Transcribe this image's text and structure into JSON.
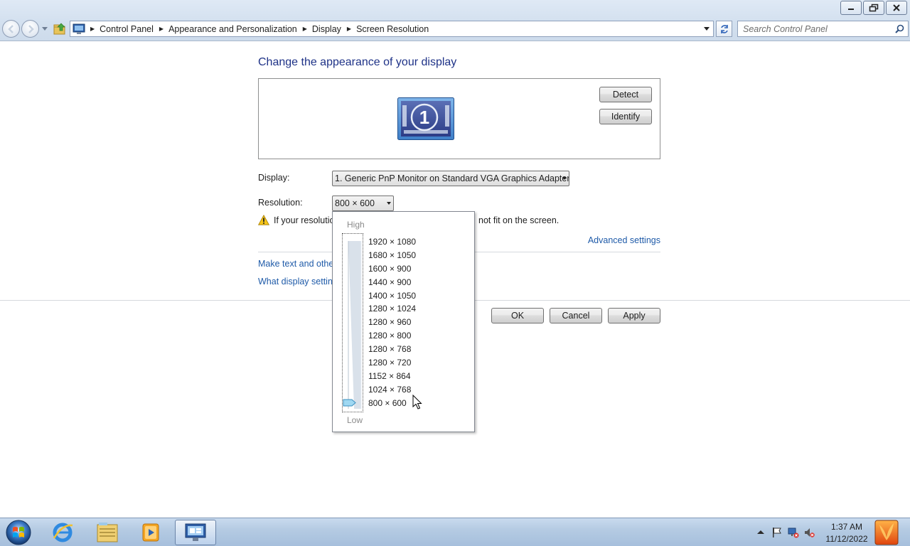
{
  "window": {
    "caption_buttons": [
      "minimize-icon",
      "restore-icon",
      "close-icon"
    ]
  },
  "nav": {
    "breadcrumbs": [
      "Control Panel",
      "Appearance and Personalization",
      "Display",
      "Screen Resolution"
    ],
    "search_placeholder": "Search Control Panel"
  },
  "main": {
    "title": "Change the appearance of your display",
    "monitor_number": "1",
    "detect_label": "Detect",
    "identify_label": "Identify",
    "display_label": "Display:",
    "display_value": "1. Generic PnP Monitor on Standard VGA Graphics Adapter",
    "resolution_label": "Resolution:",
    "resolution_value": "800 × 600",
    "warning_text_start": "If your resolutio",
    "warning_text_end": "not fit on the screen.",
    "advanced_link": "Advanced settings",
    "text_size_link": "Make text and other",
    "display_settings_link": "What display setting",
    "ok_label": "OK",
    "cancel_label": "Cancel",
    "apply_label": "Apply"
  },
  "resolution_popup": {
    "high_label": "High",
    "low_label": "Low",
    "options": [
      "1920 × 1080",
      "1680 × 1050",
      "1600 × 900",
      "1440 × 900",
      "1400 × 1050",
      "1280 × 1024",
      "1280 × 960",
      "1280 × 800",
      "1280 × 768",
      "1280 × 720",
      "1152 × 864",
      "1024 × 768",
      "800 × 600"
    ],
    "selected_index": 12
  },
  "taskbar": {
    "pinned": [
      "internet-explorer-icon",
      "windows-explorer-icon",
      "media-player-icon",
      "control-panel-icon"
    ],
    "clock_time": "1:37 AM",
    "clock_date": "11/12/2022"
  },
  "colors": {
    "title_blue": "#1e3287",
    "link_blue": "#1e5aa8",
    "taskbar": "#b5cbe3"
  }
}
